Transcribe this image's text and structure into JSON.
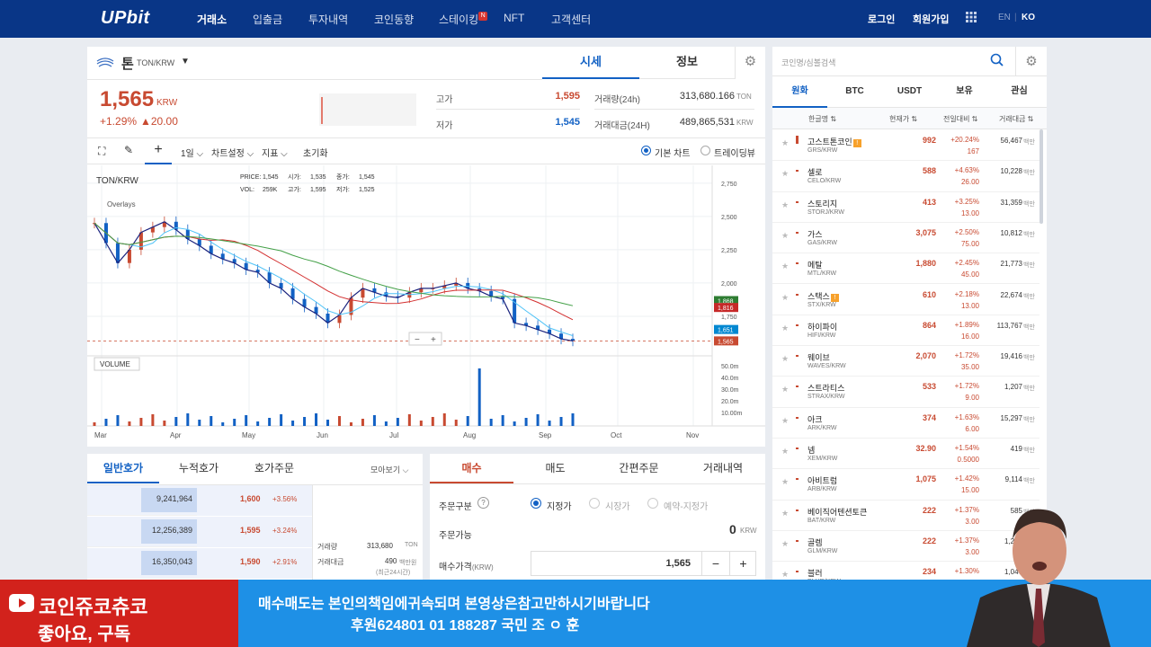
{
  "nav": {
    "logo": "UPbit",
    "items": [
      "거래소",
      "입출금",
      "투자내역",
      "코인동향",
      "스테이킹",
      "NFT",
      "고객센터"
    ],
    "staking_badge": "N",
    "login": "로그인",
    "signup": "회원가입",
    "lang_en": "EN",
    "lang_ko": "KO"
  },
  "coin": {
    "name": "톤",
    "pair": "TON/KRW",
    "price": "1,565",
    "currency": "KRW",
    "change_pct": "+1.29%",
    "change_amt": "▲20.00",
    "high_label": "고가",
    "high": "1,595",
    "low_label": "저가",
    "low": "1,545",
    "vol_label": "거래량(24h)",
    "vol": "313,680.166",
    "vol_unit": "TON",
    "amt_label": "거래대금(24H)",
    "amt": "489,865,531",
    "amt_unit": "KRW"
  },
  "tabs": {
    "market": "시세",
    "info": "정보"
  },
  "chart_toolbar": {
    "interval": "1일",
    "settings": "차트설정",
    "indicator": "지표",
    "reset": "초기화",
    "basic": "기본 차트",
    "tradingview": "트레이딩뷰"
  },
  "chart_data": {
    "type": "candlestick",
    "title": "TON/KRW",
    "overlay_label": "Overlays",
    "volume_label": "VOLUME",
    "ohlc_text": {
      "price_label": "PRICE:",
      "price": "1,545",
      "open_label": "시가:",
      "open": "1,535",
      "close_label": "종가:",
      "close": "1,545",
      "vol_label": "VOL:",
      "vol": "259K",
      "high_label": "고가:",
      "high": "1,595",
      "low_label": "저가:",
      "low": "1,525"
    },
    "x_ticks": [
      "Mar",
      "Apr",
      "May",
      "Jun",
      "Jul",
      "Aug",
      "Sep",
      "Oct",
      "Nov"
    ],
    "y_ticks": [
      "2,750",
      "2,500",
      "2,250",
      "2,000",
      "1,750"
    ],
    "vol_ticks": [
      "50.0m",
      "40.0m",
      "30.0m",
      "20.0m",
      "10.00m"
    ],
    "price_tags": [
      "1,868",
      "1,816",
      "1,651",
      "1,565"
    ],
    "close_series": [
      2450,
      2300,
      2150,
      2250,
      2380,
      2420,
      2460,
      2400,
      2330,
      2280,
      2220,
      2180,
      2150,
      2100,
      2080,
      2000,
      1960,
      1880,
      1820,
      1770,
      1700,
      1760,
      1890,
      1960,
      1930,
      1900,
      1890,
      1930,
      1960,
      1960,
      1980,
      2000,
      1960,
      1940,
      1900,
      1880,
      1700,
      1680,
      1650,
      1620,
      1580,
      1565
    ],
    "ylim": [
      1500,
      2850
    ]
  },
  "orderbook": {
    "tabs": [
      "일반호가",
      "누적호가",
      "호가주문"
    ],
    "view": "모아보기",
    "rows": [
      {
        "qty": "9,241,964",
        "price": "1,600",
        "pct": "+3.56%"
      },
      {
        "qty": "12,256,389",
        "price": "1,595",
        "pct": "+3.24%"
      },
      {
        "qty": "16,350,043",
        "price": "1,590",
        "pct": "+2.91%"
      }
    ],
    "info_vol_label": "거래량",
    "info_vol": "313,680",
    "info_vol_unit": "TON",
    "info_amt_label": "거래대금",
    "info_amt": "490",
    "info_amt_unit": "백만원",
    "info_amt_note": "(최근24시간)"
  },
  "order": {
    "tabs": [
      "매수",
      "매도",
      "간편주문",
      "거래내역"
    ],
    "type_label": "주문구분",
    "types": [
      "지정가",
      "시장가",
      "예약-지정가"
    ],
    "avail_label": "주문가능",
    "avail": "0",
    "avail_unit": "KRW",
    "price_label": "매수가격",
    "price_unit": "(KRW)",
    "price": "1,565",
    "minus": "−",
    "plus": "+"
  },
  "market": {
    "search_placeholder": "코인명/심볼검색",
    "tabs": [
      "원화",
      "BTC",
      "USDT",
      "보유",
      "관심"
    ],
    "headers": [
      "한글명",
      "현재가",
      "전일대비",
      "거래대금"
    ],
    "unit": "백만",
    "rows": [
      {
        "name": "고스트톤코인",
        "sym": "GRS/KRW",
        "price": "992",
        "pct": "+20.24%",
        "chg": "167",
        "vol": "56,467",
        "warn": true
      },
      {
        "name": "셀로",
        "sym": "CELO/KRW",
        "price": "588",
        "pct": "+4.63%",
        "chg": "26.00",
        "vol": "10,228"
      },
      {
        "name": "스토리지",
        "sym": "STORJ/KRW",
        "price": "413",
        "pct": "+3.25%",
        "chg": "13.00",
        "vol": "31,359"
      },
      {
        "name": "가스",
        "sym": "GAS/KRW",
        "price": "3,075",
        "pct": "+2.50%",
        "chg": "75.00",
        "vol": "10,812"
      },
      {
        "name": "메탈",
        "sym": "MTL/KRW",
        "price": "1,880",
        "pct": "+2.45%",
        "chg": "45.00",
        "vol": "21,773"
      },
      {
        "name": "스택스",
        "sym": "STX/KRW",
        "price": "610",
        "pct": "+2.18%",
        "chg": "13.00",
        "vol": "22,674",
        "warn": true
      },
      {
        "name": "하이파이",
        "sym": "HIFI/KRW",
        "price": "864",
        "pct": "+1.89%",
        "chg": "16.00",
        "vol": "113,767"
      },
      {
        "name": "웨이브",
        "sym": "WAVES/KRW",
        "price": "2,070",
        "pct": "+1.72%",
        "chg": "35.00",
        "vol": "19,416"
      },
      {
        "name": "스트라티스",
        "sym": "STRAX/KRW",
        "price": "533",
        "pct": "+1.72%",
        "chg": "9.00",
        "vol": "1,207"
      },
      {
        "name": "아크",
        "sym": "ARK/KRW",
        "price": "374",
        "pct": "+1.63%",
        "chg": "6.00",
        "vol": "15,297"
      },
      {
        "name": "넴",
        "sym": "XEM/KRW",
        "price": "32.90",
        "pct": "+1.54%",
        "chg": "0.5000",
        "vol": "419"
      },
      {
        "name": "아비트럼",
        "sym": "ARB/KRW",
        "price": "1,075",
        "pct": "+1.42%",
        "chg": "15.00",
        "vol": "9,114"
      },
      {
        "name": "베이직어텐션토큰",
        "sym": "BAT/KRW",
        "price": "222",
        "pct": "+1.37%",
        "chg": "3.00",
        "vol": "585"
      },
      {
        "name": "골렘",
        "sym": "GLM/KRW",
        "price": "222",
        "pct": "+1.37%",
        "chg": "3.00",
        "vol": "1,251"
      },
      {
        "name": "블러",
        "sym": "BLUR/KRW",
        "price": "234",
        "pct": "+1.30%",
        "chg": "3.00",
        "vol": "1,047"
      }
    ]
  },
  "overlay": {
    "channel": "코인쥬코츄코",
    "subscribe": "좋아요, 구독",
    "line1": "매수매도는 본인의책임에귀속되며 본영상은참고만하시기바랍니다",
    "line2": "후원624801 01 188287 국민 조 ㅇ 훈"
  }
}
